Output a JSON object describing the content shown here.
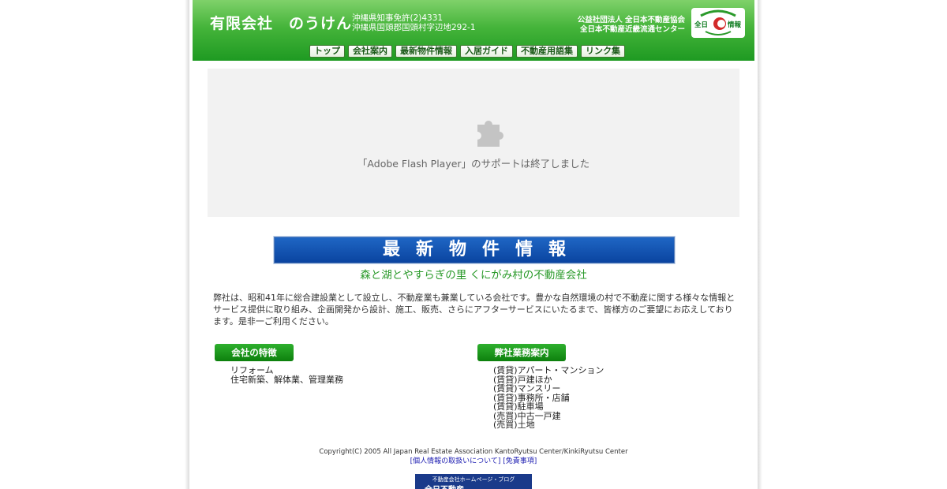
{
  "header": {
    "company": "有限会社　のうけん",
    "license_line1": "沖縄県知事免許(2)4331",
    "license_line2": "沖縄県国頭郡国頭村字辺地292-1",
    "assoc_line1": "公益社団法人 全日本不動産協会",
    "assoc_line2": "全日本不動産近畿流通センター",
    "logo_left": "全日",
    "logo_right": "情報"
  },
  "nav": [
    "トップ",
    "会社案内",
    "最新物件情報",
    "入居ガイド",
    "不動産用語集",
    "リンク集"
  ],
  "flash": {
    "icon": "puzzle-icon",
    "message": "「Adobe Flash Player」のサポートは終了しました"
  },
  "banner": {
    "title": "最新物件情報"
  },
  "subtitle": "森と湖とやすらぎの里 くにがみ村の不動産会社",
  "intro": "弊社は、昭和41年に総合建設業として設立し、不動産業も兼業している会社です。豊かな自然環境の村で不動産に関する様々な情報とサービス提供に取り組み、企画開発から設計、施工、販売、さらにアフターサービスにいたるまで、皆様方のご要望にお応えしております。是非一ご利用ください。",
  "features": {
    "title": "会社の特徴",
    "items": [
      "リフォーム",
      "住宅新築、解体業、管理業務"
    ]
  },
  "services": {
    "title": "弊社業務案内",
    "items": [
      "(賃貸)アパート・マンション",
      "(賃貸)戸建ほか",
      "(賃貸)マンスリー",
      "(賃貸)事務所・店舗",
      "(賃貸)駐車場",
      "(売買)中古一戸建",
      "(売買)土地"
    ]
  },
  "footer": {
    "copyright": "Copyright(C) 2005 All Japan Real Estate Association KantoRyutsu Center/KinkiRyutsu Center",
    "privacy": "[個人情報の取扱いについて]",
    "disclaimer": "[免責事項]",
    "banner_small": "不動産会社ホームページ・ブログ",
    "banner_big": "全日不動産"
  },
  "colors": {
    "header_green": "#1e9a22",
    "banner_blue": "#0a44a0",
    "subtitle_green": "#2a9a2a"
  }
}
